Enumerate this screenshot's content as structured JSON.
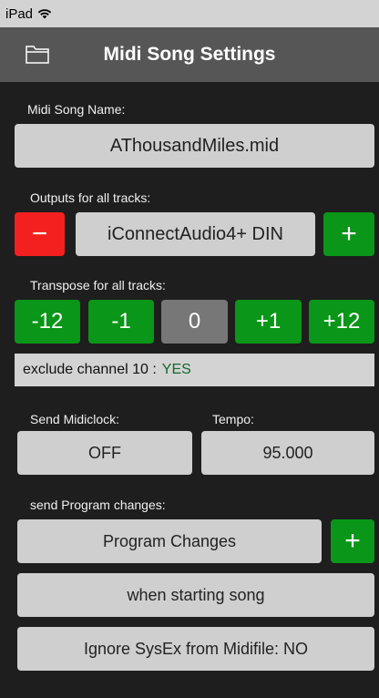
{
  "status": {
    "device": "iPad"
  },
  "nav": {
    "title": "Midi Song Settings"
  },
  "song_name": {
    "label": "Midi Song Name:",
    "value": "AThousandMiles.mid"
  },
  "outputs": {
    "label": "Outputs for all tracks:",
    "minus": "−",
    "value": "iConnectAudio4+ DIN",
    "plus": "+"
  },
  "transpose": {
    "label": "Transpose for all tracks:",
    "options": [
      "-12",
      "-1",
      "0",
      "+1",
      "+12"
    ]
  },
  "exclude": {
    "label": "exclude channel 10 :",
    "value": "YES"
  },
  "midiclock": {
    "label": "Send Midiclock:",
    "value": "OFF"
  },
  "tempo": {
    "label": "Tempo:",
    "value": "95.000"
  },
  "program": {
    "label": "send Program changes:",
    "button": "Program Changes",
    "plus": "+",
    "when": "when starting song"
  },
  "sysex": {
    "label": "Ignore SysEx from Midifile:  NO"
  },
  "colors": {
    "green": "#0a9618",
    "red": "#f42020",
    "selected": "#777777",
    "accent_value": "#12692a"
  }
}
